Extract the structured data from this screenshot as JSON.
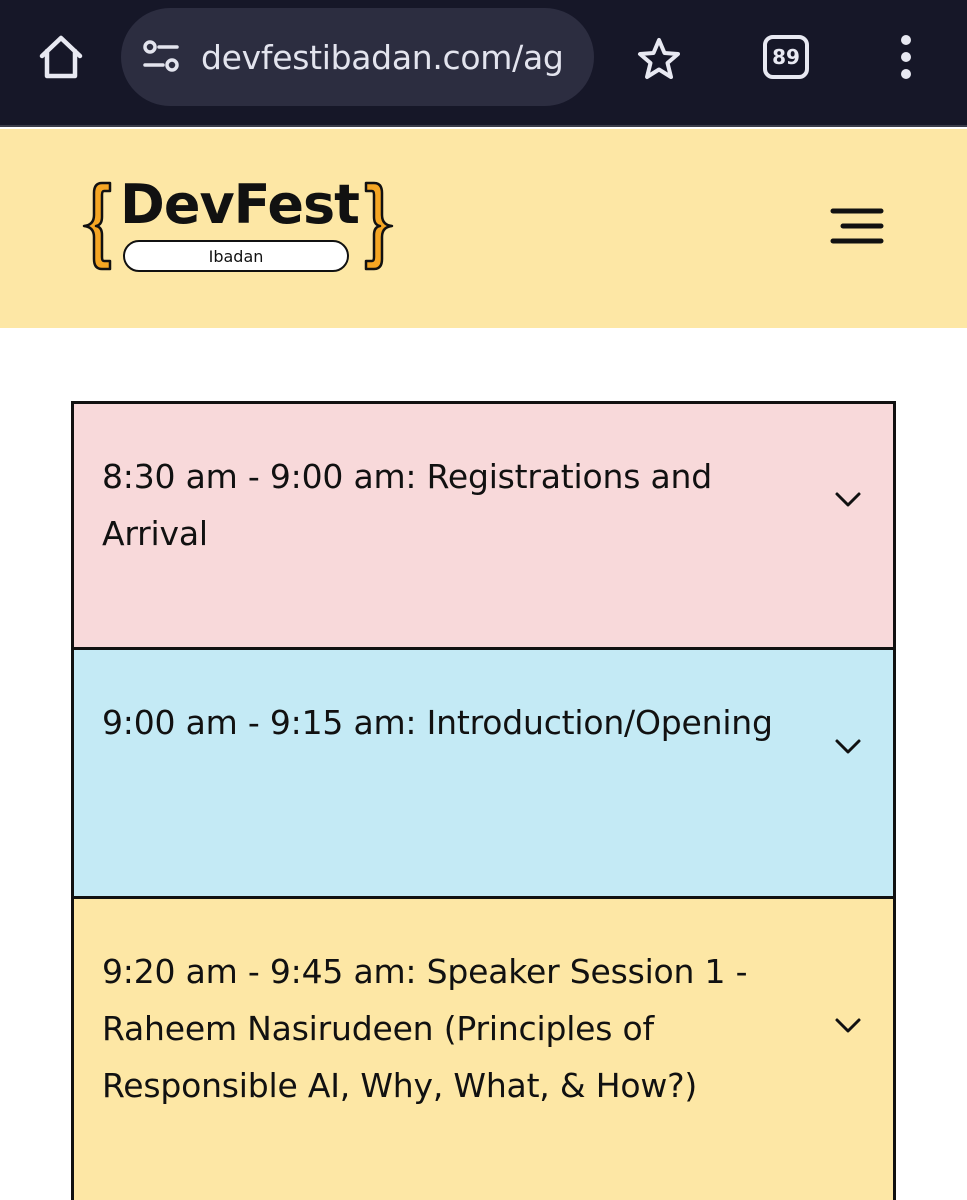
{
  "browser": {
    "url": "devfestibadan.com/ag",
    "tab_count": "89",
    "icons": [
      "home-icon",
      "site-info-icon",
      "star-icon",
      "tabs-icon",
      "menu-dots-icon"
    ]
  },
  "header": {
    "logo_word": "DevFest",
    "logo_tag": "Ibadan",
    "menu_icon": "hamburger-icon"
  },
  "agenda": {
    "items": [
      {
        "title": "8:30 am - 9:00 am: Registrations and Arrival",
        "color": "#f8d9da"
      },
      {
        "title": "9:00 am - 9:15 am: Introduction/Opening",
        "color": "#c4eaf5"
      },
      {
        "title": "9:20 am - 9:45 am: Speaker Session 1 - Raheem Nasirudeen (Principles of Responsible AI, Why, What, & How?)",
        "color": "#fde7a5"
      }
    ]
  },
  "colors": {
    "browser_bg": "#161728",
    "header_bg": "#fde7a5",
    "brace_orange": "#f5a623"
  }
}
